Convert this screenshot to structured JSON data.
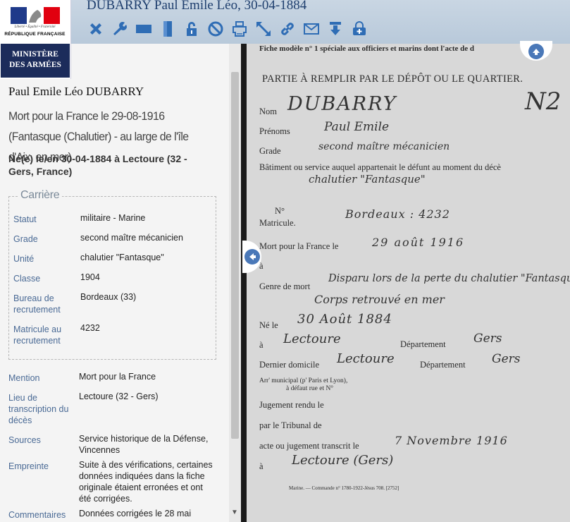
{
  "header": {
    "document_title": "DUBARRY Paul Emile Léo, 30-04-1884",
    "logo": {
      "devise": "Liberté • Égalité • Fraternité",
      "republique": "RÉPUBLIQUE FRANÇAISE",
      "ministere_line1": "MINISTÈRE",
      "ministere_line2": "DES ARMÉES"
    },
    "toolbar_icons": [
      "close-icon",
      "wrench-icon",
      "fit-width-icon",
      "fit-height-icon",
      "lock-icon",
      "block-icon",
      "print-icon",
      "fullscreen-icon",
      "link-icon",
      "mail-icon",
      "download-icon",
      "add-to-basket-icon"
    ]
  },
  "sidebar": {
    "name": "Paul Emile Léo DUBARRY",
    "death_line": "Mort pour la France le 29-08-1916 (Fantasque (Chalutier) - au large de l'île d'Aix, en mer)",
    "birth_line": "Né(e) le/en 30-04-1884 à Lectoure (32 - Gers, France)",
    "carriere": {
      "legend": "Carrière",
      "rows": [
        {
          "label": "Statut",
          "value": "militaire - Marine"
        },
        {
          "label": "Grade",
          "value": "second maître mécanicien"
        },
        {
          "label": "Unité",
          "value": "chalutier \"Fantasque\""
        },
        {
          "label": "Classe",
          "value": "1904"
        },
        {
          "label": "Bureau de recrutement",
          "value": "Bordeaux (33)"
        },
        {
          "label": "Matricule au recrutement",
          "value": "4232"
        }
      ]
    },
    "details": [
      {
        "label": "Mention",
        "value": "Mort pour la France"
      },
      {
        "label": "Lieu de transcription du décès",
        "value": "Lectoure (32 - Gers)"
      },
      {
        "label": "Sources",
        "value": "Service historique de la Défense, Vincennes"
      },
      {
        "label": "Empreinte",
        "value": "Suite à des vérifications, certaines données indiquées dans la fiche originale étaient erronées et ont été corrigées."
      },
      {
        "label": "Commentaires",
        "value": "Données corrigées le 28 mai"
      }
    ]
  },
  "document": {
    "top_line": "Fiche modèle n° 1 spéciale aux officiers et marins dont l'acte de d",
    "heading": "PARTIE À REMPLIR PAR LE DÉPÔT OU LE QUARTIER.",
    "labels": {
      "nom": "Nom",
      "prenoms": "Prénoms",
      "grade": "Grade",
      "batiment": "Bâtiment ou service auquel appartenait le défunt au moment du décè",
      "no": "N°",
      "matricule": "Matricule.",
      "mort_pour_france": "Mort pour la France le",
      "a1": "à",
      "genre_de_mort": "Genre de mort",
      "ne_le": "Né le",
      "a2": "à",
      "departement1": "Département",
      "dernier_domicile": "Dernier domicile",
      "departement2": "Département",
      "arr_municipal": "Arr' municipal (p' Paris et Lyon),",
      "a_defaut": "à défaut rue et N°",
      "jugement": "Jugement rendu le",
      "tribunal": "par le Tribunal de",
      "acte": "acte ou jugement transcrit le",
      "a3": "à",
      "footer": "Marine. — Commande n° 1780-1922-Jésus 708. [2752]"
    },
    "handwriting": {
      "nom": "DUBARRY",
      "prenoms": "Paul Emile",
      "grade": "second maître mécanicien",
      "batiment": "chalutier \"Fantasque\"",
      "matricule": "Bordeaux : 4232",
      "mort_date": "29 août 1916",
      "genre_de_mort_1": "Disparu lors de la perte du chalutier \"Fantasque\"",
      "genre_de_mort_2": "Corps retrouvé en mer",
      "naissance_date": "30 Août 1884",
      "naissance_lieu": "Lectoure",
      "departement_naissance": "Gers",
      "domicile": "Lectoure",
      "departement_domicile": "Gers",
      "transcrit_date": "7 Novembre 1916",
      "transcrit_lieu": "Lectoure (Gers)"
    }
  }
}
